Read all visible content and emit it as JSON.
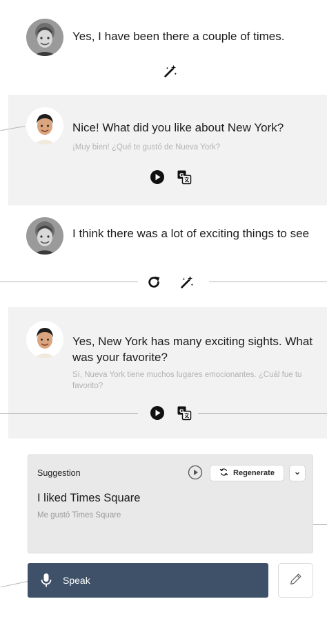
{
  "messages": [
    {
      "speaker": "user",
      "text": "Yes, I have been there a couple of times."
    },
    {
      "speaker": "tutor",
      "text": "Nice! What did you like about New York?",
      "translation": "¡Muy bien! ¿Qué te gustó de Nueva York?"
    },
    {
      "speaker": "user",
      "text": "I think there was a lot of exciting things to see"
    },
    {
      "speaker": "tutor",
      "text": "Yes, New York has many exciting sights. What was your favorite?",
      "translation": "Sí, Nueva York tiene muchos lugares emocionantes. ¿Cuál fue tu favorito?"
    }
  ],
  "suggestion": {
    "heading": "Suggestion",
    "regenerate_label": "Regenerate",
    "text": "I liked Times Square",
    "translation": "Me gustó Times Square"
  },
  "composer": {
    "speak_label": "Speak"
  },
  "icons": {
    "magic_wand": "magic-wand-icon",
    "play": "play-icon",
    "translate": "translate-icon",
    "redo": "redo-icon",
    "regenerate": "refresh-icon",
    "chevron": "chevron-down-icon",
    "microphone": "microphone-icon",
    "edit": "pencil-icon"
  },
  "colors": {
    "grey_panel": "#f2f2f2",
    "speak_button": "#3e5169",
    "connector": "#b5b5b5",
    "translation_text": "#b3b3b3"
  }
}
